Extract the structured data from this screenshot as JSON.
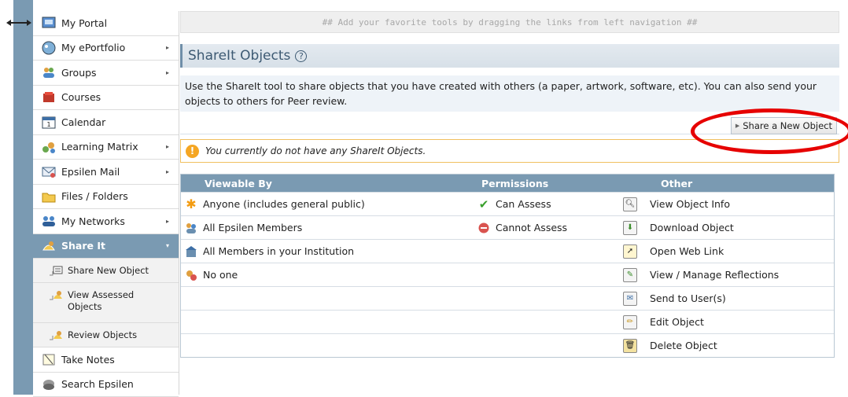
{
  "sidebar": {
    "items": [
      {
        "label": "My Portal",
        "icon": "portal-icon",
        "submenu": false
      },
      {
        "label": "My ePortfolio",
        "icon": "eportfolio-icon",
        "submenu": true
      },
      {
        "label": "Groups",
        "icon": "groups-icon",
        "submenu": true
      },
      {
        "label": "Courses",
        "icon": "courses-icon",
        "submenu": false
      },
      {
        "label": "Calendar",
        "icon": "calendar-icon",
        "submenu": false
      },
      {
        "label": "Learning Matrix",
        "icon": "learning-matrix-icon",
        "submenu": true
      },
      {
        "label": "Epsilen Mail",
        "icon": "mail-icon",
        "submenu": true
      },
      {
        "label": "Files / Folders",
        "icon": "folder-icon",
        "submenu": false
      },
      {
        "label": "My Networks",
        "icon": "networks-icon",
        "submenu": true
      },
      {
        "label": "Share It",
        "icon": "share-it-icon",
        "submenu": true,
        "active": true
      }
    ],
    "sub_items": [
      {
        "label": "Share New Object",
        "icon": "share-new-object-icon"
      },
      {
        "label": "View Assessed Objects",
        "icon": "view-assessed-icon"
      },
      {
        "label": "Review Objects",
        "icon": "review-objects-icon"
      }
    ],
    "bottom_items": [
      {
        "label": "Take Notes",
        "icon": "notes-icon"
      },
      {
        "label": "Search Epsilen",
        "icon": "search-icon"
      }
    ]
  },
  "main": {
    "favorites_hint": "## Add your favorite tools by dragging the links from left navigation ##",
    "title": "ShareIt Objects",
    "help_symbol": "?",
    "description": "Use the ShareIt tool to share objects that you have created with others (a paper, artwork, software, etc). You can also send your objects to others for Peer review.",
    "share_button": "Share a New Object",
    "notice": "You currently do not have any ShareIt Objects.",
    "table": {
      "headers": [
        "Viewable By",
        "Permissions",
        "Other"
      ],
      "viewable": [
        {
          "label": "Anyone (includes general public)",
          "icon": "asterisk-icon"
        },
        {
          "label": "All Epsilen Members",
          "icon": "members-icon"
        },
        {
          "label": "All Members in your Institution",
          "icon": "institution-icon"
        },
        {
          "label": "No one",
          "icon": "no-one-icon"
        }
      ],
      "permissions": [
        {
          "label": "Can Assess",
          "icon": "check-icon"
        },
        {
          "label": "Cannot Assess",
          "icon": "no-entry-icon"
        }
      ],
      "other": [
        {
          "label": "View Object Info",
          "icon": "magnifier-icon"
        },
        {
          "label": "Download Object",
          "icon": "download-icon"
        },
        {
          "label": "Open Web Link",
          "icon": "cursor-icon"
        },
        {
          "label": "View / Manage Reflections",
          "icon": "reflections-icon"
        },
        {
          "label": "Send to User(s)",
          "icon": "send-icon"
        },
        {
          "label": "Edit Object",
          "icon": "pencil-icon"
        },
        {
          "label": "Delete Object",
          "icon": "trash-icon"
        }
      ]
    }
  },
  "colors": {
    "accent": "#7a9ab2",
    "title_text": "#3d5a73",
    "highlight_circle": "#e60000",
    "notice_border": "#f0c060"
  }
}
